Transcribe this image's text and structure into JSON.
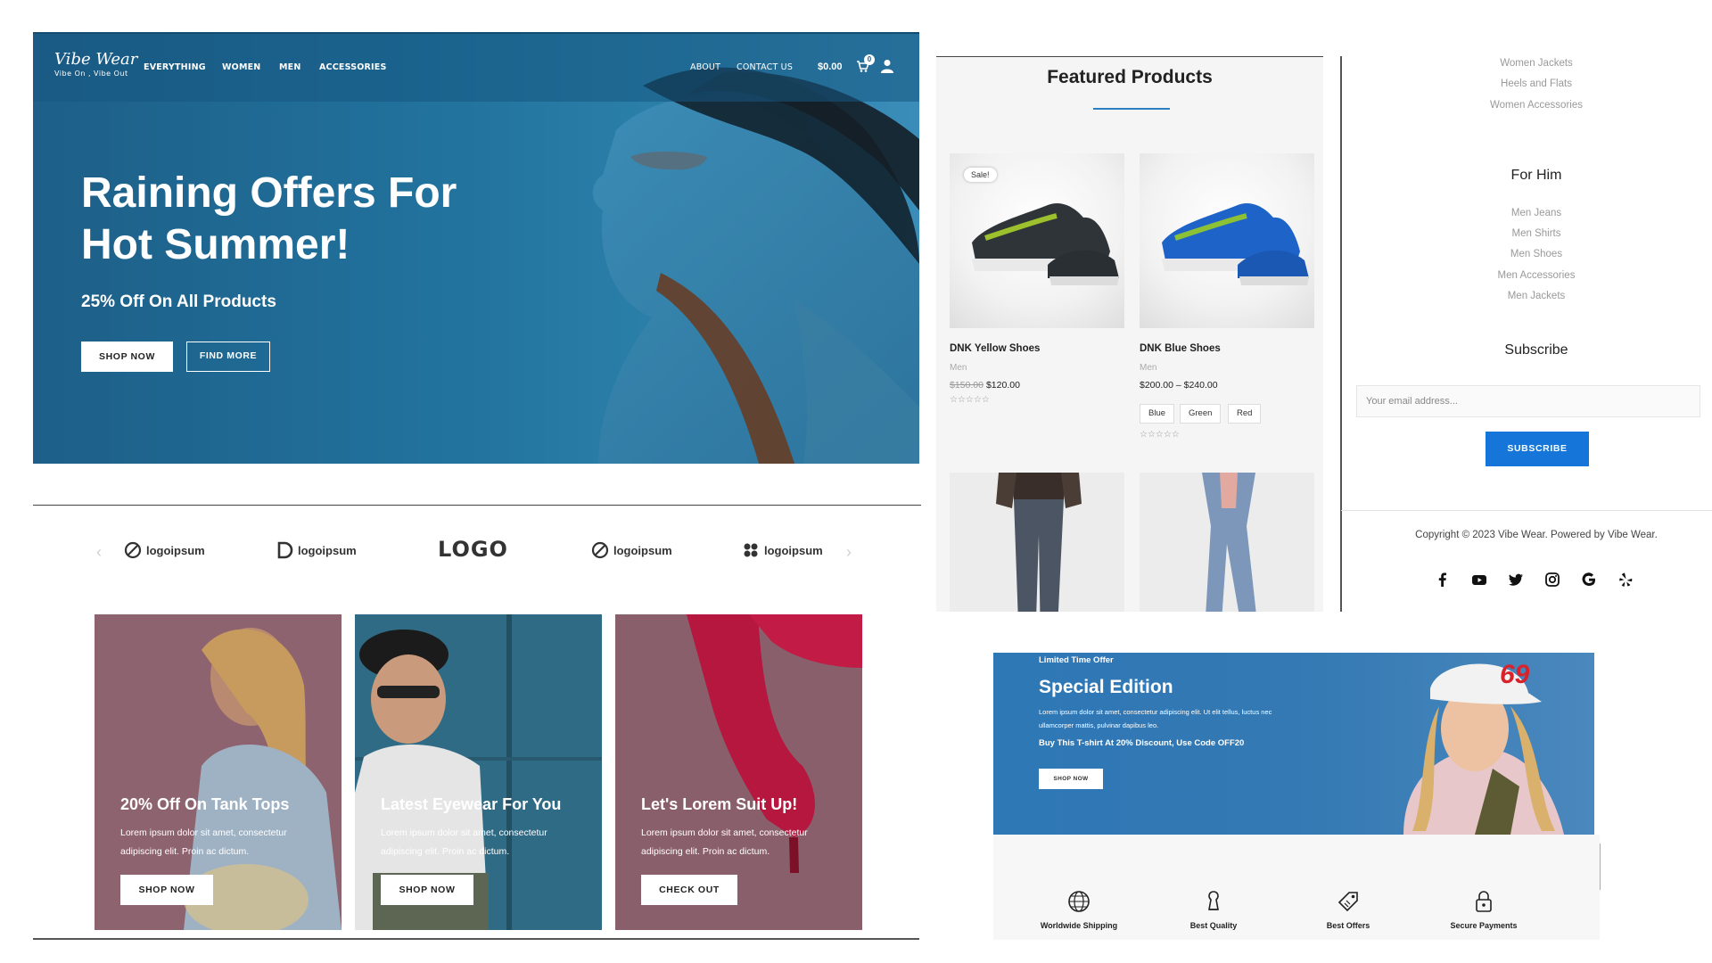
{
  "colors": {
    "hero_blue": "#21729d",
    "accent_blue": "#1575d8",
    "promo_mauve": "#8a5f6c",
    "promo_teal": "#2f6b85",
    "special_blue": "#3479b3"
  },
  "header": {
    "logo_name": "Vibe Wear",
    "logo_tagline": "Vibe On , Vibe Out",
    "nav_main": [
      "EVERYTHING",
      "WOMEN",
      "MEN",
      "ACCESSORIES"
    ],
    "nav_secondary": [
      "ABOUT",
      "CONTACT US"
    ],
    "cart_total": "$0.00",
    "cart_count": "0",
    "icons": [
      "cart-icon",
      "user-icon"
    ]
  },
  "hero": {
    "title": "Raining Offers For Hot Summer!",
    "subtitle": "25% Off On All Products",
    "primary_button": "SHOP NOW",
    "secondary_button": "FIND MORE"
  },
  "partners": {
    "logos": [
      "logoipsum",
      "logoipsum",
      "LOGO",
      "logoipsum",
      "logoipsum"
    ],
    "prev_arrow": "‹",
    "next_arrow": "›"
  },
  "promos": [
    {
      "title": "20% Off On Tank Tops",
      "text": "Lorem ipsum dolor sit amet, consectetur adipiscing elit. Proin ac dictum.",
      "button": "SHOP NOW"
    },
    {
      "title": "Latest Eyewear For You",
      "text": "Lorem ipsum dolor sit amet, consectetur adipiscing elit. Proin ac dictum.",
      "button": "SHOP NOW"
    },
    {
      "title": "Let's Lorem Suit Up!",
      "text": "Lorem ipsum dolor sit amet, consectetur adipiscing elit. Proin ac dictum.",
      "button": "CHECK OUT"
    }
  ],
  "featured": {
    "title": "Featured Products",
    "products": [
      {
        "name": "DNK Yellow Shoes",
        "category": "Men",
        "old_price": "$150.00",
        "price": "$120.00",
        "badge": "Sale!",
        "stars": "☆☆☆☆☆"
      },
      {
        "name": "DNK Blue Shoes",
        "category": "Men",
        "price": "$200.00 – $240.00",
        "stars": "☆☆☆☆☆",
        "swatches": [
          "Blue",
          "Green",
          "Red"
        ]
      }
    ]
  },
  "sidebar": {
    "women_links": [
      "Women Jackets",
      "Heels and Flats",
      "Women Accessories"
    ],
    "for_him_heading": "For Him",
    "men_links": [
      "Men Jeans",
      "Men Shirts",
      "Men Shoes",
      "Men Accessories",
      "Men Jackets"
    ],
    "subscribe_heading": "Subscribe",
    "email_placeholder": "Your email address...",
    "subscribe_button": "SUBSCRIBE",
    "copyright": "Copyright © 2023 Vibe Wear. Powered by Vibe Wear.",
    "social_icons": [
      "facebook-icon",
      "youtube-icon",
      "twitter-icon",
      "instagram-icon",
      "google-icon",
      "yelp-icon"
    ]
  },
  "special": {
    "eyebrow": "Limited Time Offer",
    "title": "Special Edition",
    "text": "Lorem ipsum dolor sit amet, consectetur adipiscing elit. Ut elit tellus, luctus nec ullamcorper mattis, pulvinar dapibus leo.",
    "code_line": "Buy This T-shirt At 20% Discount, Use Code OFF20",
    "button": "SHOP NOW",
    "cap_number": "69"
  },
  "features": [
    {
      "label": "Worldwide Shipping",
      "icon": "globe-icon"
    },
    {
      "label": "Best Quality",
      "icon": "quality-icon"
    },
    {
      "label": "Best Offers",
      "icon": "tag-icon"
    },
    {
      "label": "Secure Payments",
      "icon": "lock-icon"
    }
  ]
}
